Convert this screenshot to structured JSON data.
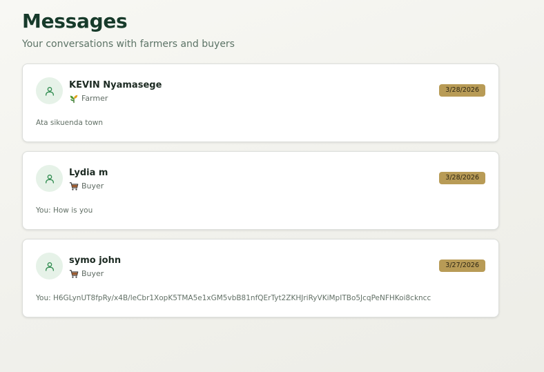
{
  "header": {
    "title": "Messages",
    "subtitle": "Your conversations with farmers and buyers"
  },
  "colors": {
    "accent_green": "#2e8b4e",
    "avatar_bg": "#e6f2e8",
    "date_badge": "#b89b56",
    "title_text": "#173a2a"
  },
  "conversations": [
    {
      "name": "KEVIN Nyamasege",
      "role": "Farmer",
      "role_icon": "plant-icon",
      "date": "3/28/2026",
      "preview": "Ata sikuenda town",
      "avatar_icon": "user-icon"
    },
    {
      "name": "Lydia m",
      "role": "Buyer",
      "role_icon": "cart-icon",
      "date": "3/28/2026",
      "preview": "You: How is you",
      "avatar_icon": "user-icon"
    },
    {
      "name": "symo john",
      "role": "Buyer",
      "role_icon": "cart-icon",
      "date": "3/27/2026",
      "preview": "You: H6GLynUT8fpRy/x4B/leCbr1XopK5TMA5e1xGM5vbB81nfQErTyt2ZKHJriRyVKiMpITBo5JcqPeNFHKoi8ckncc",
      "avatar_icon": "user-icon"
    }
  ]
}
